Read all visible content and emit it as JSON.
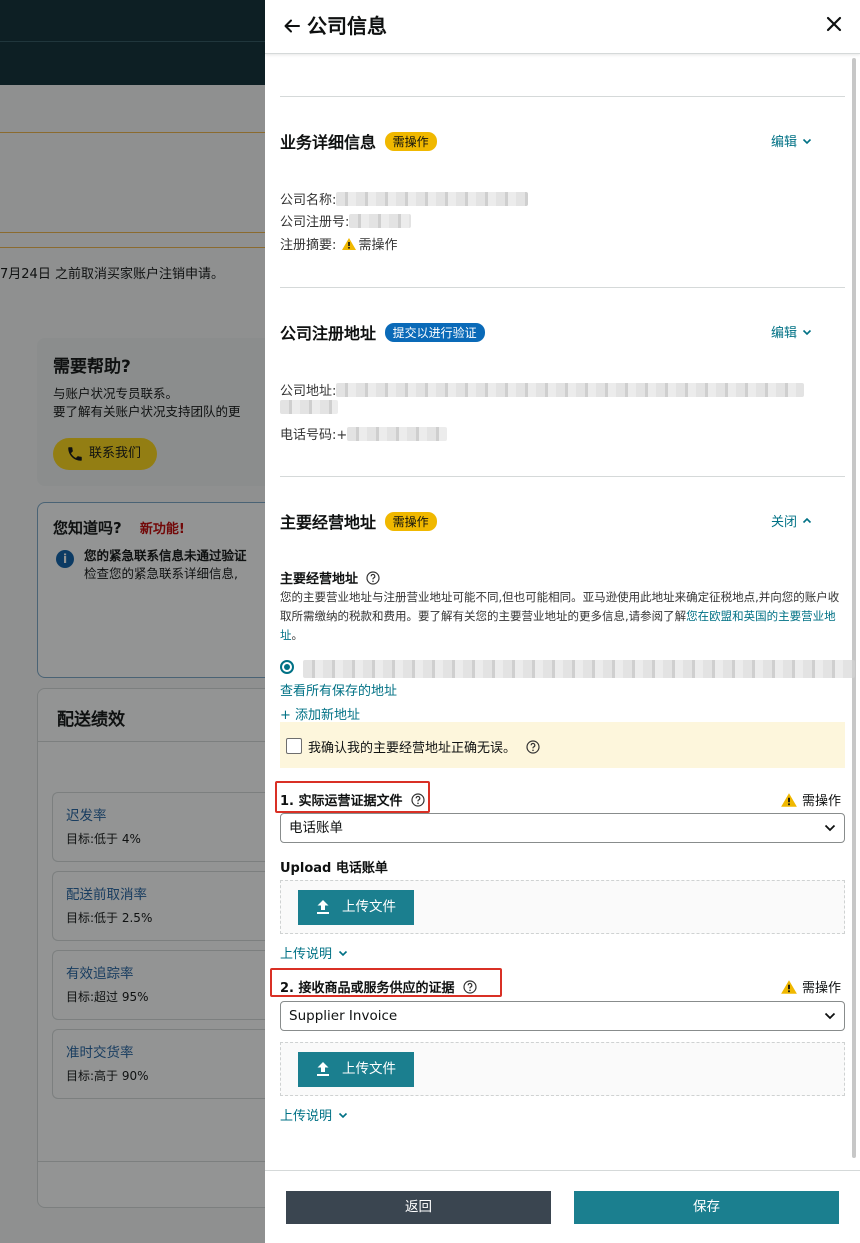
{
  "background": {
    "notice": "7月24日 之前取消买家账户注销申请。",
    "help": {
      "title": "需要帮助?",
      "line1": "与账户状况专员联系。",
      "line2": "要了解有关账户状况支持团队的更",
      "button": "联系我们"
    },
    "did_you_know": {
      "title": "您知道吗?",
      "new_label": "新功能!",
      "line1": "您的紧急联系信息未通过验证",
      "line2": "检查您的紧急联系详细信息,"
    },
    "performance": {
      "title": "配送绩效",
      "metrics": [
        {
          "name": "迟发率",
          "goal": "目标:低于 4%"
        },
        {
          "name": "配送前取消率",
          "goal": "目标:低于 2.5%"
        },
        {
          "name": "有效追踪率",
          "goal": "目标:超过 95%"
        },
        {
          "name": "准时交货率",
          "goal": "目标:高于 90%"
        }
      ]
    }
  },
  "panel": {
    "title": "公司信息",
    "business": {
      "title": "业务详细信息",
      "badge": "需操作",
      "action": "编辑",
      "company_name_label": "公司名称:",
      "reg_number_label": "公司注册号:",
      "summary_label": "注册摘要:",
      "summary_value": "需操作"
    },
    "registered": {
      "title": "公司注册地址",
      "badge": "提交以进行验证",
      "action": "编辑",
      "address_label": "公司地址:",
      "phone_label": "电话号码:",
      "phone_prefix": "+"
    },
    "primary": {
      "title": "主要经营地址",
      "badge": "需操作",
      "action": "关闭",
      "sub_title": "主要经营地址",
      "desc": "您的主要营业地址与注册营业地址可能不同,但也可能相同。亚马逊使用此地址来确定征税地点,并向您的账户收取所需缴纳的税款和费用。要了解有关您的主要营业地址的更多信息,请参阅了解",
      "desc_link": "您在欧盟和英国的主要营业地址",
      "desc_end": "。",
      "view_all": "查看所有保存的地址",
      "add_new": "+ 添加新地址",
      "confirm": "我确认我的主要经营地址正确无误。"
    },
    "doc1": {
      "title": "1. 实际运营证据文件",
      "need": "需操作",
      "selected": "电话账单",
      "upload_label": "Upload 电话账单",
      "upload_button": "上传文件",
      "instructions": "上传说明"
    },
    "doc2": {
      "title": "2. 接收商品或服务供应的证据",
      "need": "需操作",
      "selected": "Supplier Invoice",
      "upload_button": "上传文件",
      "instructions": "上传说明"
    },
    "footer": {
      "back": "返回",
      "save": "保存"
    }
  },
  "colors": {
    "accent": "#007185",
    "primary_button": "#1b7f8f",
    "secondary_button": "#3a4550",
    "warning_badge": "#f0b800",
    "info_badge": "#0a6ab8",
    "highlight_box": "#d93025"
  }
}
